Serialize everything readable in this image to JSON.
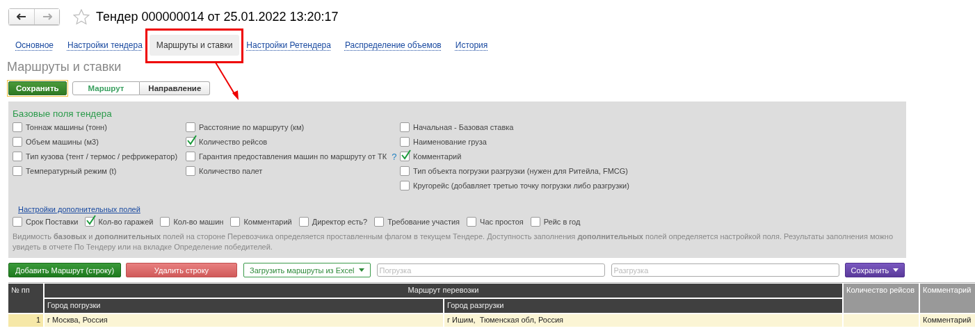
{
  "title": "Тендер 000000014 от 25.01.2022 13:20:17",
  "tabs": [
    {
      "label": "Основное",
      "selected": false
    },
    {
      "label": "Настройки тендера",
      "selected": false
    },
    {
      "label": "Маршруты и ставки",
      "selected": true
    },
    {
      "label": "Настройки Ретендера",
      "selected": false
    },
    {
      "label": "Распределение объемов",
      "selected": false
    },
    {
      "label": "История",
      "selected": false
    }
  ],
  "section_title": "Маршруты и ставки",
  "save_button": "Сохранить",
  "view_toggle": [
    {
      "label": "Маршрут",
      "selected": true
    },
    {
      "label": "Направление",
      "selected": false
    }
  ],
  "base_fields": {
    "title": "Базовые поля тендера",
    "columns": [
      [
        {
          "label": "Тоннаж машины (тонн)",
          "checked": false
        },
        {
          "label": "Объем машины (м3)",
          "checked": false
        },
        {
          "label": "Тип кузова (тент / термос / рефрижератор)",
          "checked": false
        },
        {
          "label": "Температурный режим (t)",
          "checked": false
        }
      ],
      [
        {
          "label": "Расстояние по маршруту (км)",
          "checked": false
        },
        {
          "label": "Количество рейсов",
          "checked": true
        },
        {
          "label": "Гарантия предоставления машин по маршруту от ТК",
          "checked": false,
          "help": "?"
        },
        {
          "label": "Количество палет",
          "checked": false
        }
      ],
      [
        {
          "label": "Начальная - Базовая ставка",
          "checked": false
        },
        {
          "label": "Наименование груза",
          "checked": false
        },
        {
          "label": "Комментарий",
          "checked": true
        },
        {
          "label": "Тип объекта погрузки разгрузки (нужен для Ритейла, FMCG)",
          "checked": false
        },
        {
          "label": "Кругорейс (добавляет третью точку погрузки либо разгрузки)",
          "checked": false
        }
      ]
    ]
  },
  "extra_fields": {
    "link": "Настройки дополнительных полей",
    "items": [
      {
        "label": "Срок Поставки",
        "checked": false
      },
      {
        "label": "Кол-во гаражей",
        "checked": true
      },
      {
        "label": "Кол-во машин",
        "checked": false
      },
      {
        "label": "Комментарий",
        "checked": false
      },
      {
        "label": "Директор есть?",
        "checked": false
      },
      {
        "label": "Требование участия",
        "checked": false
      },
      {
        "label": "Час простоя",
        "checked": false
      },
      {
        "label": "Рейс в год",
        "checked": false
      }
    ]
  },
  "note": "Видимость **базовых** и **дополнительных** полей на стороне Перевозчика определяется проставленным флагом в текущем Тендере. Доступность заполнения **дополнительных** полей определяется настройкой поля. Результаты заполнения можно увидеть в отчете По Тендеру или на вкладке Определение победителей.",
  "toolbar": {
    "add_button": "Добавить Маршрут (строку)",
    "delete_button": "Удалить строку",
    "load_button": "Загрузить маршруты из Excel",
    "loading_placeholder": "Погрузка",
    "unloading_placeholder": "Разгрузка",
    "save_button": "Сохранить"
  },
  "table": {
    "columns": {
      "number": "№ пп",
      "route": "Маршрут перевозки",
      "from": "Город погрузки",
      "to": "Город разгрузки",
      "trips": "Количество рейсов",
      "comment": "Комментарий"
    },
    "rows": [
      {
        "number": "1",
        "from": "г Москва, Россия",
        "to": "г Ишим,  Тюменская обл, Россия",
        "comment": "Комментарий"
      }
    ]
  }
}
